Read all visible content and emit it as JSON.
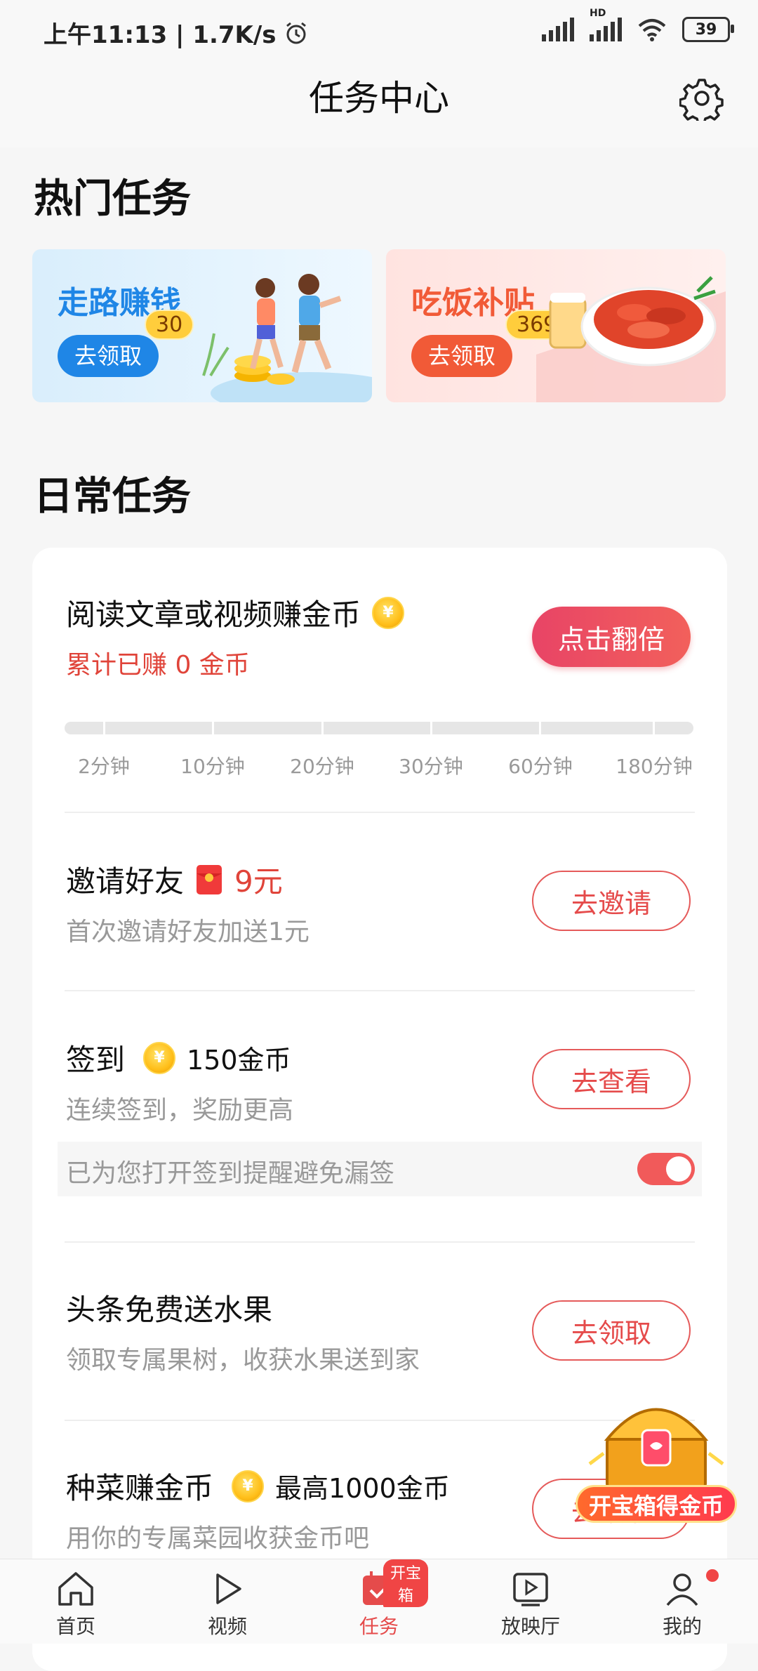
{
  "status": {
    "time_speed": "上午11:13 | 1.7K/s",
    "hd": "HD",
    "battery": "39"
  },
  "header": {
    "title": "任务中心"
  },
  "hot": {
    "title": "热门任务",
    "cards": [
      {
        "title": "走路赚钱",
        "badge": "30",
        "button": "去领取",
        "bg": "#e3f2ff",
        "color": "#1f86e6"
      },
      {
        "title": "吃饭补贴",
        "badge": "369",
        "button": "去领取",
        "bg": "#ffe5e3",
        "color": "#f15a37"
      }
    ]
  },
  "daily": {
    "title": "日常任务",
    "read": {
      "title": "阅读文章或视频赚金币",
      "earned": "累计已赚 0 金币",
      "button": "点击翻倍",
      "progress_labels": [
        "2分钟",
        "10分钟",
        "20分钟",
        "30分钟",
        "60分钟",
        "180分钟"
      ]
    },
    "invite": {
      "title": "邀请好友",
      "reward": "9元",
      "sub": "首次邀请好友加送1元",
      "button": "去邀请"
    },
    "signin": {
      "title": "签到",
      "reward": "150金币",
      "sub": "连续签到，奖励更高",
      "button": "去查看",
      "reminder": "已为您打开签到提醒避免漏签"
    },
    "fruit": {
      "title": "头条免费送水果",
      "sub": "领取专属果树，收获水果送到家",
      "button": "去领取"
    },
    "veg": {
      "title": "种菜赚金币",
      "reward": "最高1000金币",
      "sub": "用你的专属菜园收获金币吧",
      "button": "去领取"
    }
  },
  "treasure": {
    "label": "开宝箱得金币"
  },
  "tabs": [
    {
      "label": "首页"
    },
    {
      "label": "视频"
    },
    {
      "label": "任务",
      "badge": "开宝箱"
    },
    {
      "label": "放映厅"
    },
    {
      "label": "我的"
    }
  ]
}
